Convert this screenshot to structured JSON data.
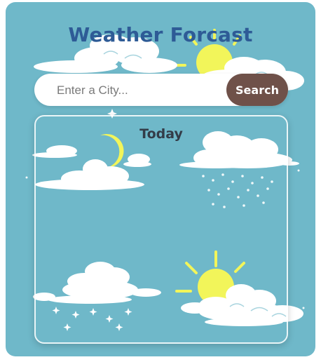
{
  "app": {
    "title": "Weather Forcast"
  },
  "search": {
    "placeholder": "Enter a City...",
    "value": "",
    "button_label": "Search"
  },
  "card": {
    "title": "Today"
  },
  "colors": {
    "background": "#6fb8c9",
    "title": "#2e5b96",
    "search_button": "#6f5149",
    "sun": "#f2f55a",
    "cloud": "#ffffff"
  },
  "icons": [
    "sun-behind-cloud-icon",
    "moon-cloud-icon",
    "rain-cloud-icon",
    "snow-cloud-icon",
    "sun-cloud-icon"
  ]
}
